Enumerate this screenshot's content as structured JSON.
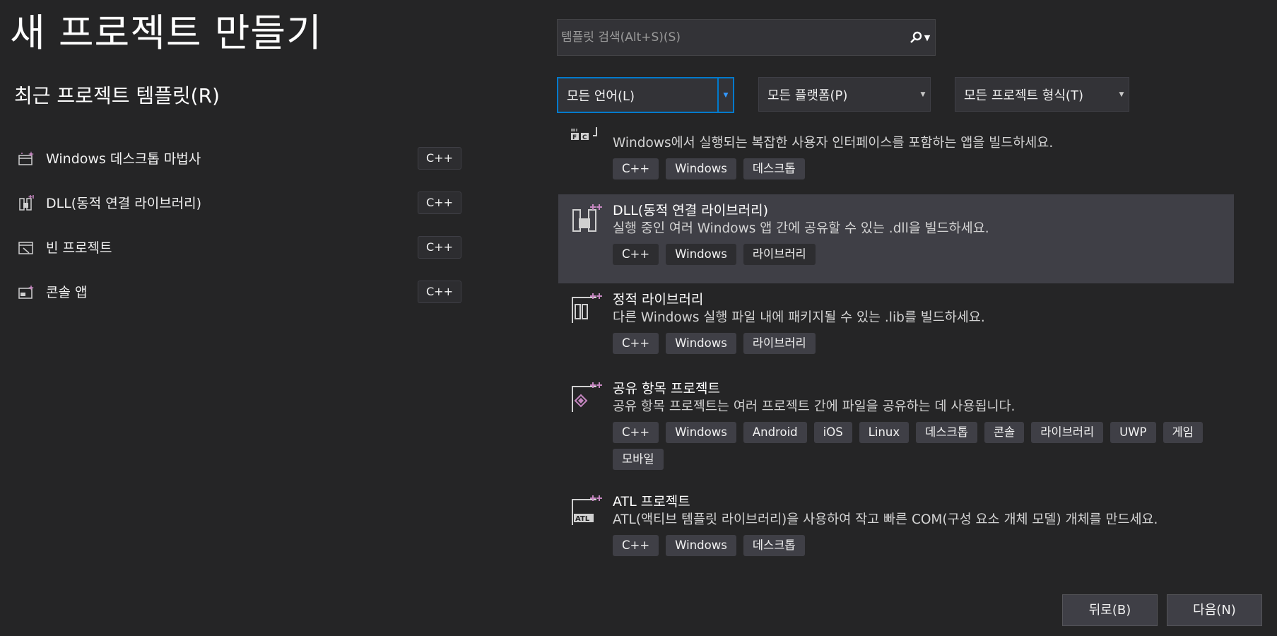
{
  "title": "새 프로젝트 만들기",
  "recent": {
    "heading": "최근 프로젝트 템플릿(R)",
    "items": [
      {
        "label": "Windows 데스크톱 마법사",
        "tag": "C++"
      },
      {
        "label": "DLL(동적 연결 라이브러리)",
        "tag": "C++"
      },
      {
        "label": "빈 프로젝트",
        "tag": "C++"
      },
      {
        "label": "콘솔 앱",
        "tag": "C++"
      }
    ]
  },
  "search": {
    "placeholder": "템플릿 검색(Alt+S)(S)",
    "value": ""
  },
  "filters": {
    "language": "모든 언어(L)",
    "platform": "모든 플랫폼(P)",
    "project_type": "모든 프로젝트 형식(T)"
  },
  "templates": [
    {
      "name": "",
      "desc": "Windows에서 실행되는 복잡한 사용자 인터페이스를 포함하는 앱을 빌드하세요.",
      "tags": [
        "C++",
        "Windows",
        "데스크톱"
      ],
      "icon": "mfc-icon"
    },
    {
      "name": "DLL(동적 연결 라이브러리)",
      "desc": "실행 중인 여러 Windows 앱 간에 공유할 수 있는 .dll을 빌드하세요.",
      "tags": [
        "C++",
        "Windows",
        "라이브러리"
      ],
      "icon": "dll-icon",
      "selected": true
    },
    {
      "name": "정적 라이브러리",
      "desc": "다른 Windows 실행 파일 내에 패키지될 수 있는 .lib를 빌드하세요.",
      "tags": [
        "C++",
        "Windows",
        "라이브러리"
      ],
      "icon": "static-library-icon"
    },
    {
      "name": "공유 항목 프로젝트",
      "desc": "공유 항목 프로젝트는 여러 프로젝트 간에 파일을 공유하는 데 사용됩니다.",
      "tags": [
        "C++",
        "Windows",
        "Android",
        "iOS",
        "Linux",
        "데스크톱",
        "콘솔",
        "라이브러리",
        "UWP",
        "게임",
        "모바일"
      ],
      "icon": "shared-items-icon"
    },
    {
      "name": "ATL 프로젝트",
      "desc": "ATL(액티브 템플릿 라이브러리)을 사용하여 작고 빠른 COM(구성 요소 개체 모델) 개체를 만드세요.",
      "tags": [
        "C++",
        "Windows",
        "데스크톱"
      ],
      "icon": "atl-icon"
    }
  ],
  "buttons": {
    "back": "뒤로(B)",
    "next": "다음(N)"
  },
  "colors": {
    "background": "#252526",
    "accent": "#007acc",
    "selected": "#3f3f46",
    "icon_accent": "#c586c0"
  }
}
